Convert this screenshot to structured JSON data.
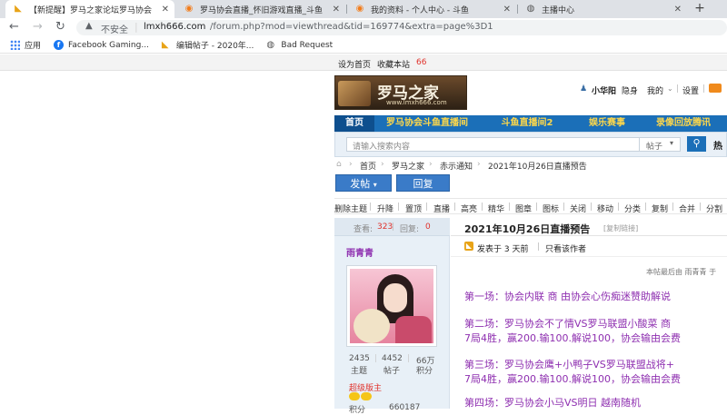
{
  "browser": {
    "tabs": [
      {
        "title": "【新提醒】罗马之家论坛罗马协会",
        "active": true
      },
      {
        "title": "罗马协会直播_怀旧游戏直播_斗鱼",
        "active": false
      },
      {
        "title": "我的资料 - 个人中心 - 斗鱼",
        "active": false
      },
      {
        "title": "主播中心",
        "active": false
      }
    ],
    "new_tab": "+",
    "insecure_label": "不安全",
    "url_domain": "lmxh666.com",
    "url_path": "/forum.php?mod=viewthread&tid=169774&extra=page%3D1",
    "bookmarks": [
      {
        "label": "应用",
        "icon": "apps-grid-icon"
      },
      {
        "label": "Facebook Gaming...",
        "icon": "facebook-icon"
      },
      {
        "label": "编辑帖子 - 2020年...",
        "icon": "forum-bookmark-icon"
      },
      {
        "label": "Bad Request",
        "icon": "globe-icon"
      }
    ]
  },
  "top_strip": {
    "set_home": "设为首页",
    "bookmark_site": "收藏本站",
    "count": "66"
  },
  "site": {
    "logo_text": "罗马之家",
    "logo_sub": "www.lmxh666.com",
    "user_name": "小华阳",
    "user_status": "隐身",
    "my_menu": "我的",
    "settings": "设置",
    "nav": [
      "首页",
      "罗马协会斗鱼直播间",
      "斗鱼直播间2",
      "娱乐赛事",
      "录像回放腾讯"
    ],
    "search_placeholder": "请输入搜索内容",
    "search_scope": "帖子",
    "search_hot": "热",
    "breadcrumb": [
      "首页",
      "罗马之家",
      "赤示通知",
      "2021年10月26日直播预告"
    ],
    "post_button": "发帖",
    "reply_button": "回复",
    "mod_tools": [
      "删除主题",
      "升降",
      "置顶",
      "直播",
      "高亮",
      "精华",
      "图章",
      "图标",
      "关闭",
      "移动",
      "分类",
      "复制",
      "合并",
      "分割"
    ]
  },
  "thread": {
    "views_label": "查看:",
    "views": "323",
    "replies_label": "回复:",
    "replies": "0",
    "title": "2021年10月26日直播预告",
    "copy_link": "[复制链接]",
    "posted": "发表于 3 天前",
    "author_only": "只看该作者",
    "edited_note": "本帖最后由 雨青青 于",
    "lines": [
      "第一场：协会内联 商 由协会心伤痴迷赞助解说",
      "第二场：罗马协会不了情VS罗马联盟小酸菜 商",
      "7局4胜，赢200.输100.解说100，协会输由会费",
      "第三场：罗马协会鹰+小鸭子VS罗马联盟战将+",
      "7局4胜，赢200.输100.解说100，协会输由会费",
      "第四场：罗马协会小马VS明日 越南随机"
    ]
  },
  "author": {
    "name": "雨青青",
    "stats": [
      {
        "value": "2435",
        "label": "主题"
      },
      {
        "value": "4452",
        "label": "帖子"
      },
      {
        "value": "66万",
        "label": "积分"
      }
    ],
    "rank": "超级版主",
    "points_label": "积分",
    "points_value": "660187"
  },
  "colors": {
    "nav_blue": "#1b6fb8",
    "accent_red": "#e0312b",
    "post_purple": "#8e2fb0",
    "button_blue": "#3a7bc8"
  }
}
